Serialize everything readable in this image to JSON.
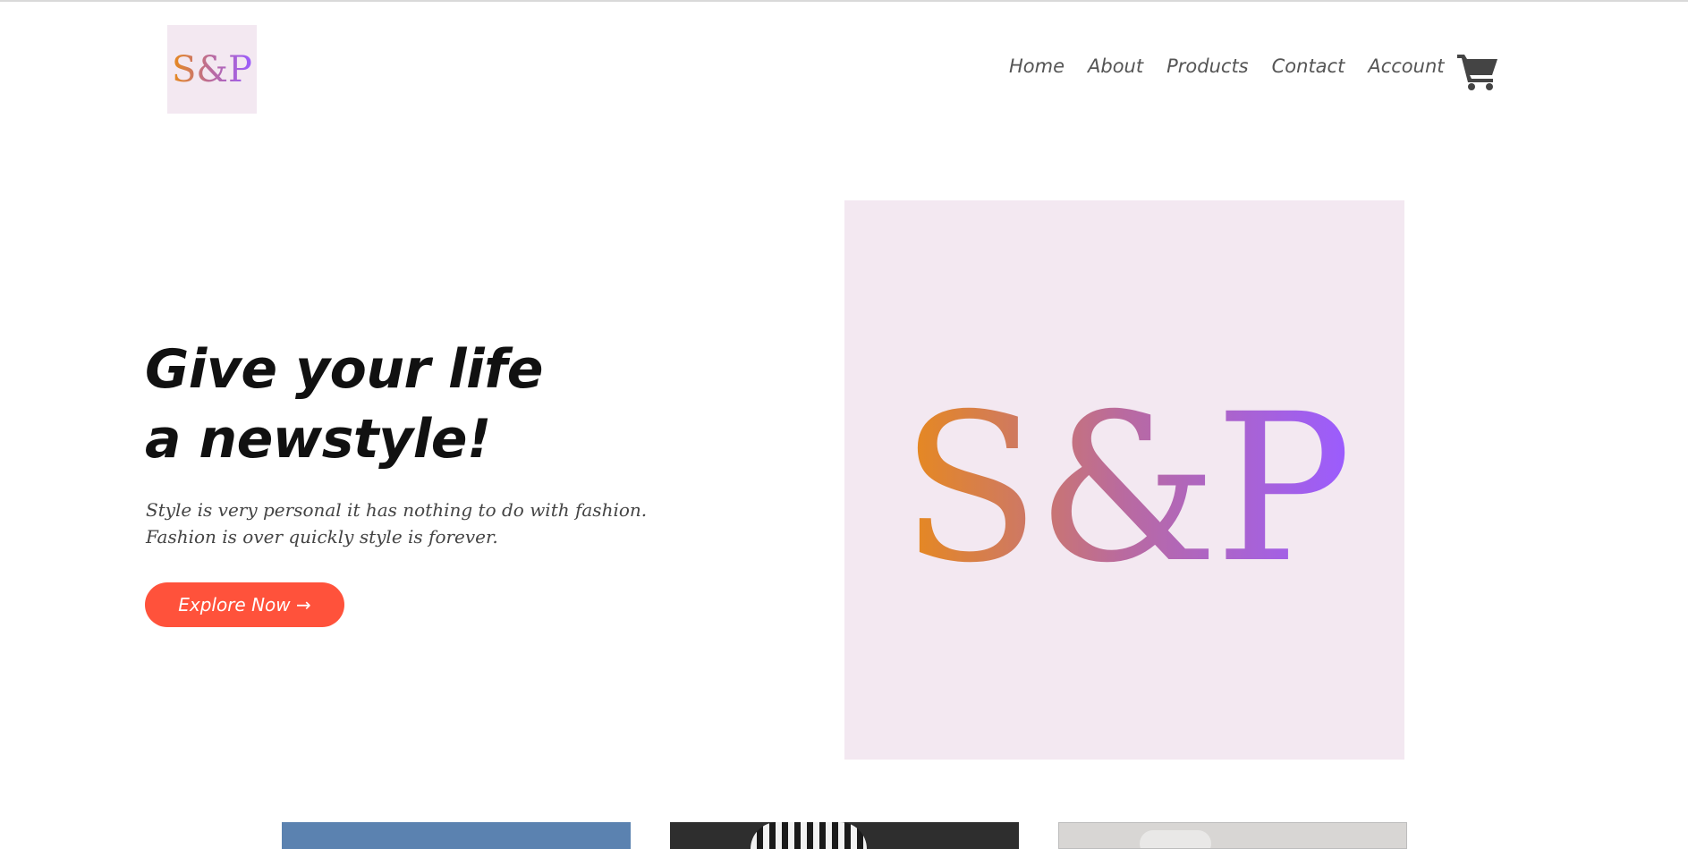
{
  "brand": {
    "logo_text": "S&P",
    "gradient_colors": [
      "#e88a1a",
      "#b96aa0",
      "#9b5cff"
    ],
    "tile_background": "#f3e8f1"
  },
  "nav": {
    "items": [
      {
        "label": "Home"
      },
      {
        "label": "About"
      },
      {
        "label": "Products"
      },
      {
        "label": "Contact"
      },
      {
        "label": "Account"
      }
    ],
    "cart_icon": "shopping-cart-icon"
  },
  "hero": {
    "title_line1": "Give your life",
    "title_line2": "a newstyle!",
    "subtitle_line1": "Style is very personal it has nothing to do with fashion.",
    "subtitle_line2": "Fashion is over quickly style is forever.",
    "cta_label": "Explore Now →",
    "cta_color": "#ff523b",
    "image_text": "S&P"
  },
  "featured": {
    "thumbnails": [
      {
        "name": "featured-image-1"
      },
      {
        "name": "featured-image-2"
      },
      {
        "name": "featured-image-3"
      }
    ]
  }
}
